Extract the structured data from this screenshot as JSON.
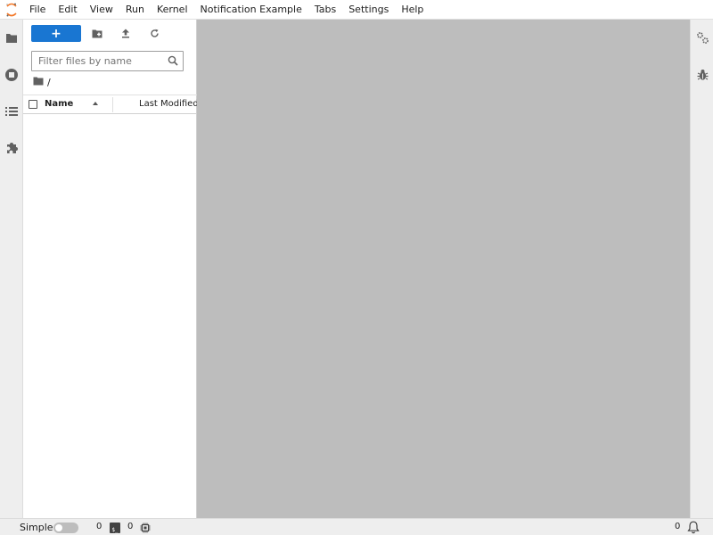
{
  "menubar": {
    "items": [
      "File",
      "Edit",
      "View",
      "Run",
      "Kernel",
      "Notification Example",
      "Tabs",
      "Settings",
      "Help"
    ]
  },
  "left_sidebar": {
    "tabs": [
      "folder-icon",
      "running-icon",
      "toc-icon",
      "extension-icon"
    ]
  },
  "file_browser": {
    "new_button_label": "+",
    "filter_placeholder": "Filter files by name",
    "breadcrumb": "/",
    "columns": {
      "name": "Name",
      "modified": "Last Modified"
    },
    "files": []
  },
  "right_sidebar": {
    "tabs": [
      "property-inspector-icon",
      "debugger-icon"
    ]
  },
  "statusbar": {
    "simple_label": "Simple",
    "simple_enabled": false,
    "terminals_count": "0",
    "kernels_count": "0",
    "notifications_count": "0"
  },
  "colors": {
    "accent": "#1976d2",
    "main_area": "#bdbdbd",
    "sidebar": "#eeeeee"
  }
}
